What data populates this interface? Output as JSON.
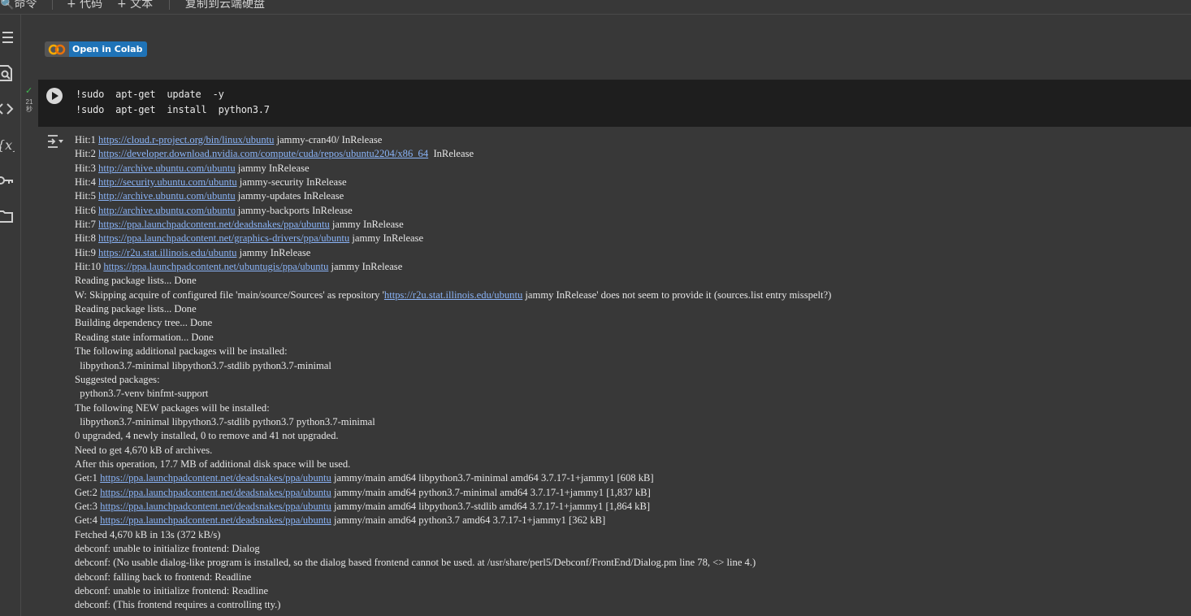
{
  "toolbar": {
    "command_label": "命令",
    "add_code_label": "+ 代码",
    "add_text_label": "+ 文本",
    "copy_label": "复制到云端硬盘"
  },
  "badge": {
    "label": "Open in Colab"
  },
  "cell": {
    "status_check": "✓",
    "exec_time": "21",
    "exec_unit": "秒",
    "code_lines": [
      "!sudo  apt-get  update  -y",
      "!sudo  apt-get  install  python3.7"
    ]
  },
  "output_lines": [
    [
      "Hit:1 ",
      {
        "link": "https://cloud.r-project.org/bin/linux/ubuntu"
      },
      " jammy-cran40/ InRelease"
    ],
    [
      "Hit:2 ",
      {
        "link": "https://developer.download.nvidia.com/compute/cuda/repos/ubuntu2204/x86_64"
      },
      "  InRelease"
    ],
    [
      "Hit:3 ",
      {
        "link": "http://archive.ubuntu.com/ubuntu"
      },
      " jammy InRelease"
    ],
    [
      "Hit:4 ",
      {
        "link": "http://security.ubuntu.com/ubuntu"
      },
      " jammy-security InRelease"
    ],
    [
      "Hit:5 ",
      {
        "link": "http://archive.ubuntu.com/ubuntu"
      },
      " jammy-updates InRelease"
    ],
    [
      "Hit:6 ",
      {
        "link": "http://archive.ubuntu.com/ubuntu"
      },
      " jammy-backports InRelease"
    ],
    [
      "Hit:7 ",
      {
        "link": "https://ppa.launchpadcontent.net/deadsnakes/ppa/ubuntu"
      },
      " jammy InRelease"
    ],
    [
      "Hit:8 ",
      {
        "link": "https://ppa.launchpadcontent.net/graphics-drivers/ppa/ubuntu"
      },
      " jammy InRelease"
    ],
    [
      "Hit:9 ",
      {
        "link": "https://r2u.stat.illinois.edu/ubuntu"
      },
      " jammy InRelease"
    ],
    [
      "Hit:10 ",
      {
        "link": "https://ppa.launchpadcontent.net/ubuntugis/ppa/ubuntu"
      },
      " jammy InRelease"
    ],
    [
      "Reading package lists... Done"
    ],
    [
      "W: Skipping acquire of configured file 'main/source/Sources' as repository '",
      {
        "link": "https://r2u.stat.illinois.edu/ubuntu"
      },
      " jammy InRelease' does not seem to provide it (sources.list entry misspelt?)"
    ],
    [
      "Reading package lists... Done"
    ],
    [
      "Building dependency tree... Done"
    ],
    [
      "Reading state information... Done"
    ],
    [
      "The following additional packages will be installed:"
    ],
    [
      "  libpython3.7-minimal libpython3.7-stdlib python3.7-minimal"
    ],
    [
      "Suggested packages:"
    ],
    [
      "  python3.7-venv binfmt-support"
    ],
    [
      "The following NEW packages will be installed:"
    ],
    [
      "  libpython3.7-minimal libpython3.7-stdlib python3.7 python3.7-minimal"
    ],
    [
      "0 upgraded, 4 newly installed, 0 to remove and 41 not upgraded."
    ],
    [
      "Need to get 4,670 kB of archives."
    ],
    [
      "After this operation, 17.7 MB of additional disk space will be used."
    ],
    [
      "Get:1 ",
      {
        "link": "https://ppa.launchpadcontent.net/deadsnakes/ppa/ubuntu"
      },
      " jammy/main amd64 libpython3.7-minimal amd64 3.7.17-1+jammy1 [608 kB]"
    ],
    [
      "Get:2 ",
      {
        "link": "https://ppa.launchpadcontent.net/deadsnakes/ppa/ubuntu"
      },
      " jammy/main amd64 python3.7-minimal amd64 3.7.17-1+jammy1 [1,837 kB]"
    ],
    [
      "Get:3 ",
      {
        "link": "https://ppa.launchpadcontent.net/deadsnakes/ppa/ubuntu"
      },
      " jammy/main amd64 libpython3.7-stdlib amd64 3.7.17-1+jammy1 [1,864 kB]"
    ],
    [
      "Get:4 ",
      {
        "link": "https://ppa.launchpadcontent.net/deadsnakes/ppa/ubuntu"
      },
      " jammy/main amd64 python3.7 amd64 3.7.17-1+jammy1 [362 kB]"
    ],
    [
      "Fetched 4,670 kB in 13s (372 kB/s)"
    ],
    [
      "debconf: unable to initialize frontend: Dialog"
    ],
    [
      "debconf: (No usable dialog-like program is installed, so the dialog based frontend cannot be used. at /usr/share/perl5/Debconf/FrontEnd/Dialog.pm line 78, <> line 4.)"
    ],
    [
      "debconf: falling back to frontend: Readline"
    ],
    [
      "debconf: unable to initialize frontend: Readline"
    ],
    [
      "debconf: (This frontend requires a controlling tty.)"
    ]
  ],
  "colors": {
    "background": "#383838",
    "code_bg": "#1e1e1e",
    "link": "#8ab4f8",
    "badge": "#1f73b7",
    "check": "#3fb950"
  },
  "icons": [
    "table-of-contents-icon",
    "find-replace-icon",
    "code-snippets-icon",
    "variables-icon",
    "secrets-key-icon",
    "files-folder-icon",
    "run-cell-icon",
    "output-actions-icon"
  ]
}
